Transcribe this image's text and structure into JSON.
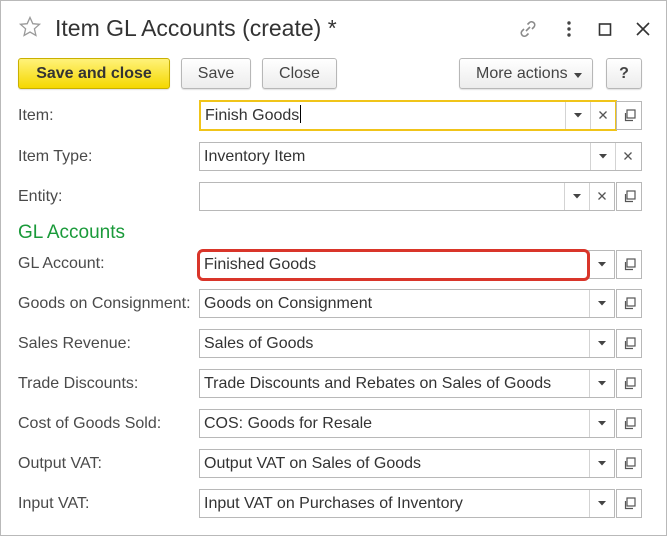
{
  "window": {
    "title": "Item GL Accounts (create) *"
  },
  "toolbar": {
    "save_close": "Save and close",
    "save": "Save",
    "close": "Close",
    "more_actions": "More actions",
    "help": "?"
  },
  "fields": {
    "item": {
      "label": "Item:",
      "value": "Finish Goods"
    },
    "item_type": {
      "label": "Item Type:",
      "value": "Inventory Item"
    },
    "entity": {
      "label": "Entity:",
      "value": ""
    }
  },
  "section": {
    "title": "GL Accounts"
  },
  "gl": {
    "gl_account": {
      "label": "GL Account:",
      "value": "Finished Goods"
    },
    "consignment": {
      "label": "Goods on Consignment:",
      "value": "Goods on Consignment"
    },
    "sales_revenue": {
      "label": "Sales Revenue:",
      "value": "Sales of Goods"
    },
    "trade_discounts": {
      "label": "Trade Discounts:",
      "value": "Trade Discounts and Rebates on Sales of Goods"
    },
    "cogs": {
      "label": "Cost of Goods Sold:",
      "value": "COS: Goods for Resale"
    },
    "output_vat": {
      "label": "Output VAT:",
      "value": "Output VAT on Sales of Goods"
    },
    "input_vat": {
      "label": "Input VAT:",
      "value": "Input VAT on Purchases of Inventory"
    }
  },
  "colors": {
    "primary_button": "#f5d800",
    "section_title": "#1a9a3a",
    "highlight_border": "#d9352a",
    "focus_border": "#f0c419"
  }
}
